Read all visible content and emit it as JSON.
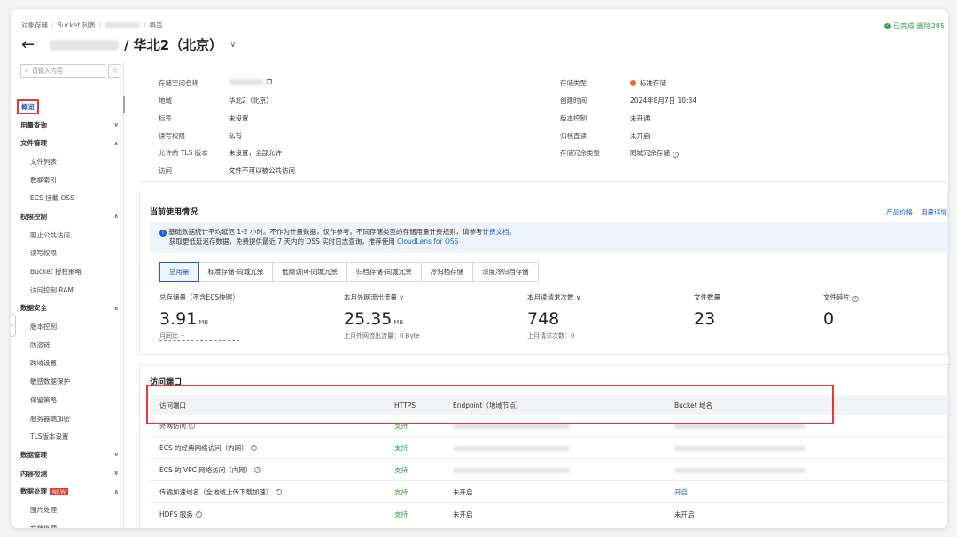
{
  "breadcrumb": {
    "items": [
      "对象存储",
      "Bucket 列表",
      "概览"
    ]
  },
  "status": {
    "text": "已完成 删除285"
  },
  "header": {
    "title": "/ 华北2（北京）"
  },
  "sidebar": {
    "search_placeholder": "请输入内容",
    "items": [
      {
        "label": "概览",
        "type": "active"
      },
      {
        "label": "用量查询",
        "type": "group",
        "arrow": "∨"
      },
      {
        "label": "文件管理",
        "type": "group",
        "arrow": "∧"
      },
      {
        "label": "文件列表",
        "type": "sub"
      },
      {
        "label": "数据索引",
        "type": "sub"
      },
      {
        "label": "ECS 挂载 OSS",
        "type": "sub"
      },
      {
        "label": "权限控制",
        "type": "group",
        "arrow": "∧"
      },
      {
        "label": "阻止公共访问",
        "type": "sub"
      },
      {
        "label": "读写权限",
        "type": "sub"
      },
      {
        "label": "Bucket 授权策略",
        "type": "sub"
      },
      {
        "label": "访问控制 RAM",
        "type": "sub"
      },
      {
        "label": "数据安全",
        "type": "group",
        "arrow": "∧"
      },
      {
        "label": "版本控制",
        "type": "sub"
      },
      {
        "label": "防盗链",
        "type": "sub"
      },
      {
        "label": "跨域设置",
        "type": "sub"
      },
      {
        "label": "敏感数据保护",
        "type": "sub"
      },
      {
        "label": "保留策略",
        "type": "sub"
      },
      {
        "label": "服务器端加密",
        "type": "sub"
      },
      {
        "label": "TLS版本设置",
        "type": "sub"
      },
      {
        "label": "数据管理",
        "type": "group",
        "arrow": "∨"
      },
      {
        "label": "内容检测",
        "type": "group",
        "arrow": "∨"
      },
      {
        "label": "数据处理",
        "type": "group",
        "arrow": "∧",
        "badge": "NEW"
      },
      {
        "label": "图片处理",
        "type": "sub"
      },
      {
        "label": "文档处理",
        "type": "sub"
      }
    ]
  },
  "info": {
    "left": [
      {
        "k": "存储空间名称",
        "v": ""
      },
      {
        "k": "地域",
        "v": "华北2（北京）"
      },
      {
        "k": "标签",
        "v": "未设置"
      },
      {
        "k": "读写权限",
        "v": "私有"
      },
      {
        "k": "允许的 TLS 版本",
        "v": "未设置，全部允许"
      },
      {
        "k": "访问",
        "v": "文件不可以被公共访问"
      }
    ],
    "right": [
      {
        "k": "存储类型",
        "v": "标准存储"
      },
      {
        "k": "创建时间",
        "v": "2024年8月7日 10:34"
      },
      {
        "k": "版本控制",
        "v": "未开通"
      },
      {
        "k": "归档直读",
        "v": "未开启"
      },
      {
        "k": "存储冗余类型",
        "v": "同城冗余存储"
      }
    ]
  },
  "usage": {
    "title": "当前使用情况",
    "links": [
      "产品价格",
      "用量详情"
    ],
    "notice_line1": "基础数据统计平均延迟 1-2 小时。不作为计量数据，仅作参考。不同存储类型的存储用量计费规则，请参考",
    "notice_link1": "计费文档",
    "notice_line1_end": "。",
    "notice_line2": "获取更低延迟存数据，免费提供最近 7 天内的 OSS 实时日志查询，推荐使用",
    "notice_link2": "CloudLens for OSS",
    "tabs": [
      "总用量",
      "标准存储-同城冗余",
      "低频访问-同城冗余",
      "归档存储-同城冗余",
      "冷归档存储",
      "深度冷归档存储"
    ],
    "metrics": [
      {
        "label": "总存储量（不含ECS快照）",
        "value": "3.91",
        "unit": "MB",
        "sub": "月同比 --"
      },
      {
        "label": "本月外网流出流量",
        "value": "25.35",
        "unit": "MB",
        "sub": "上月外网流出流量：0 Byte"
      },
      {
        "label": "本月读请求次数",
        "value": "748",
        "unit": "",
        "sub": "上月请求次数：0"
      },
      {
        "label": "文件数量",
        "value": "23",
        "unit": "",
        "sub": ""
      },
      {
        "label": "文件碎片",
        "value": "0",
        "unit": "",
        "sub": ""
      }
    ]
  },
  "ports": {
    "title": "访问端口",
    "headers": [
      "访问端口",
      "HTTPS",
      "Endpoint（地域节点）",
      "Bucket 域名"
    ],
    "rows": [
      {
        "name": "外网访问",
        "https": "支持",
        "endpoint": "",
        "domain": ""
      },
      {
        "name": "ECS 的经典网络访问（内网）",
        "https": "支持",
        "endpoint": "",
        "domain": ""
      },
      {
        "name": "ECS 的 VPC 网络访问（内网）",
        "https": "支持",
        "endpoint": "",
        "domain": ""
      },
      {
        "name": "传输加速域名（全地域上传下载加速）",
        "https": "支持",
        "endpoint": "未开启",
        "domain": "开启"
      },
      {
        "name": "HDFS 服务",
        "https": "支持",
        "endpoint": "未开启",
        "domain": "未开启"
      }
    ]
  }
}
